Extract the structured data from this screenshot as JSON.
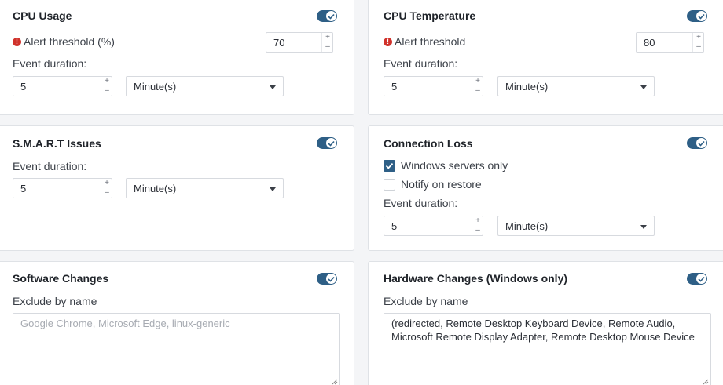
{
  "toggle_color": "#2e5f86",
  "alert_color": "#d0322b",
  "cpu_usage": {
    "title": "CPU Usage",
    "enabled": true,
    "threshold_label": "Alert threshold (%)",
    "threshold_value": "70",
    "duration_label": "Event duration:",
    "duration_value": "5",
    "unit": "Minute(s)"
  },
  "cpu_temperature": {
    "title": "CPU Temperature",
    "enabled": true,
    "threshold_label": "Alert threshold",
    "threshold_value": "80",
    "duration_label": "Event duration:",
    "duration_value": "5",
    "unit": "Minute(s)"
  },
  "smart_issues": {
    "title": "S.M.A.R.T Issues",
    "enabled": true,
    "duration_label": "Event duration:",
    "duration_value": "5",
    "unit": "Minute(s)"
  },
  "connection_loss": {
    "title": "Connection Loss",
    "enabled": true,
    "windows_only_label": "Windows servers only",
    "windows_only_checked": true,
    "notify_restore_label": "Notify on restore",
    "notify_restore_checked": false,
    "duration_label": "Event duration:",
    "duration_value": "5",
    "unit": "Minute(s)"
  },
  "software_changes": {
    "title": "Software Changes",
    "enabled": true,
    "exclude_label": "Exclude by name",
    "exclude_placeholder": "Google Chrome, Microsoft Edge, linux-generic",
    "exclude_value": ""
  },
  "hardware_changes": {
    "title": "Hardware Changes (Windows only)",
    "enabled": true,
    "exclude_label": "Exclude by name",
    "exclude_value": "(redirected, Remote Desktop Keyboard Device, Remote Audio, Microsoft Remote Display Adapter, Remote Desktop Mouse Device"
  },
  "stepper": {
    "up": "+",
    "down": "–"
  },
  "icons": {
    "alert": "exclamation-circle-icon",
    "toggle": "check-icon",
    "dropdown": "caret-down-icon"
  }
}
